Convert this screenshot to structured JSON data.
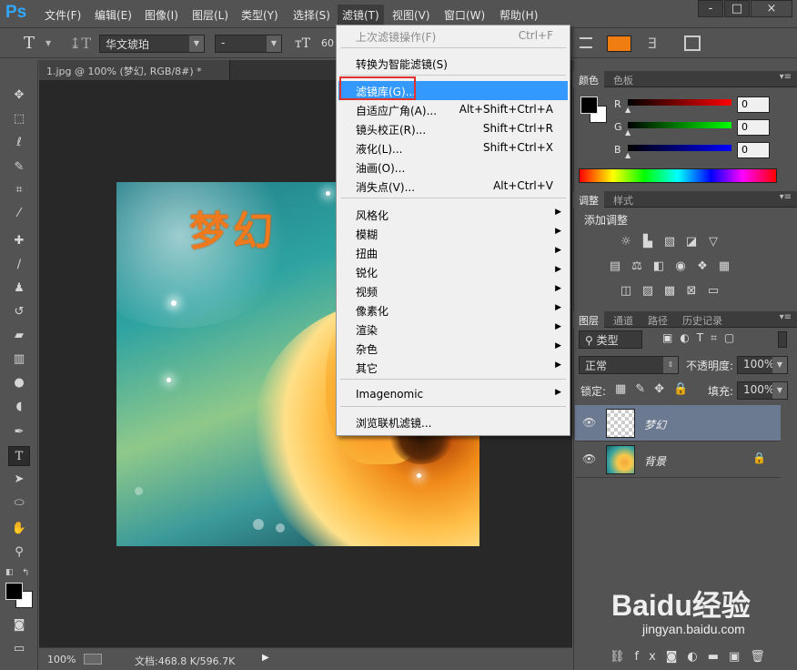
{
  "app": {
    "logo": "Ps"
  },
  "menubar": {
    "items": [
      "文件(F)",
      "编辑(E)",
      "图像(I)",
      "图层(L)",
      "类型(Y)",
      "选择(S)",
      "滤镜(T)",
      "视图(V)",
      "窗口(W)",
      "帮助(H)"
    ],
    "active": "滤镜(T)",
    "window_buttons": [
      "-",
      "□",
      "×"
    ]
  },
  "optionsbar": {
    "tool_glyph": "T",
    "font_family": "华文琥珀",
    "font_style": "-",
    "font_size": "60",
    "color": "#f07d12"
  },
  "document": {
    "tab_label": "1.jpg @ 100% (梦幻, RGB/8#) *",
    "canvas_text": "梦幻"
  },
  "statusbar": {
    "zoom": "100%",
    "doc_info": "文档:468.8 K/596.7K"
  },
  "filter_menu": {
    "items": [
      {
        "label": "上次滤镜操作(F)",
        "shortcut": "Ctrl+F",
        "disabled": true
      },
      {
        "sep": true
      },
      {
        "label": "转换为智能滤镜(S)"
      },
      {
        "sep": true
      },
      {
        "label": "滤镜库(G)...",
        "highlighted": true
      },
      {
        "label": "自适应广角(A)...",
        "shortcut": "Alt+Shift+Ctrl+A"
      },
      {
        "label": "镜头校正(R)...",
        "shortcut": "Shift+Ctrl+R"
      },
      {
        "label": "液化(L)...",
        "shortcut": "Shift+Ctrl+X"
      },
      {
        "label": "油画(O)..."
      },
      {
        "label": "消失点(V)...",
        "shortcut": "Alt+Ctrl+V"
      },
      {
        "sep": true
      },
      {
        "label": "风格化",
        "submenu": true
      },
      {
        "label": "模糊",
        "submenu": true
      },
      {
        "label": "扭曲",
        "submenu": true
      },
      {
        "label": "锐化",
        "submenu": true
      },
      {
        "label": "视频",
        "submenu": true
      },
      {
        "label": "像素化",
        "submenu": true
      },
      {
        "label": "渲染",
        "submenu": true
      },
      {
        "label": "杂色",
        "submenu": true
      },
      {
        "label": "其它",
        "submenu": true
      },
      {
        "sep": true
      },
      {
        "label": "Imagenomic",
        "submenu": true
      },
      {
        "sep": true
      },
      {
        "label": "浏览联机滤镜..."
      }
    ],
    "submenu_arrow": "▶"
  },
  "color_panel": {
    "tabs": [
      "颜色",
      "色板"
    ],
    "channels": [
      {
        "label": "R",
        "value": "0",
        "color": "#ff0000"
      },
      {
        "label": "G",
        "value": "0",
        "color": "#00ff00"
      },
      {
        "label": "B",
        "value": "0",
        "color": "#0000ff"
      }
    ]
  },
  "adjustments_panel": {
    "tabs": [
      "调整",
      "样式"
    ],
    "title": "添加调整"
  },
  "layers_panel": {
    "tabs": [
      "图层",
      "通道",
      "路径",
      "历史记录"
    ],
    "filter_kind": "类型",
    "blend_mode": "正常",
    "opacity_label": "不透明度:",
    "opacity_value": "100%",
    "lock_label": "锁定:",
    "fill_label": "填充:",
    "fill_value": "100%",
    "layers": [
      {
        "name": "梦幻",
        "selected": true
      },
      {
        "name": "背景",
        "locked": true
      }
    ]
  },
  "watermark": {
    "text": "Baidu经验",
    "url": "jingyan.baidu.com"
  }
}
